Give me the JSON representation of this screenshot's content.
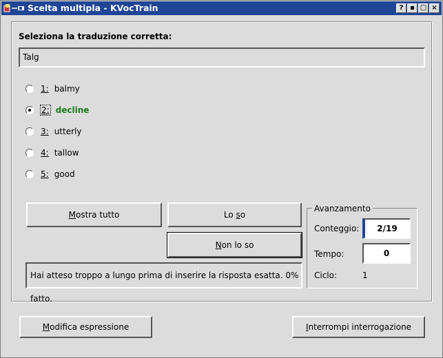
{
  "window": {
    "title": "Scelta multipla - KVocTrain",
    "buttons": [
      "?",
      "▪",
      "□",
      "×"
    ]
  },
  "prompt": {
    "label": "Seleziona la traduzione corretta:",
    "word": "Talg"
  },
  "options": [
    {
      "num": "1:",
      "text": "balmy",
      "selected": false
    },
    {
      "num": "2:",
      "text": "decline",
      "selected": true
    },
    {
      "num": "3:",
      "text": "utterly",
      "selected": false
    },
    {
      "num": "4:",
      "text": "tallow",
      "selected": false
    },
    {
      "num": "5:",
      "text": "good",
      "selected": false
    }
  ],
  "actions": {
    "show_all": {
      "u": "M",
      "rest": "ostra tutto"
    },
    "know_it": {
      "pre": "Lo ",
      "u": "s",
      "rest": "o"
    },
    "dont_know": {
      "u": "N",
      "rest": "on lo so"
    }
  },
  "status_text": "Hai atteso troppo a lungo prima di inserire la risposta esatta. 0% fatto.",
  "progress": {
    "title": "Avanzamento",
    "count_label": "Conteggio:",
    "count_value": "2/19",
    "time_label": "Tempo:",
    "time_value": "0",
    "cycle_label": "Ciclo:",
    "cycle_value": "1"
  },
  "footer": {
    "edit": {
      "u": "M",
      "rest": "odifica espressione"
    },
    "stop": {
      "u": "I",
      "rest": "nterrompi interrogazione"
    }
  }
}
